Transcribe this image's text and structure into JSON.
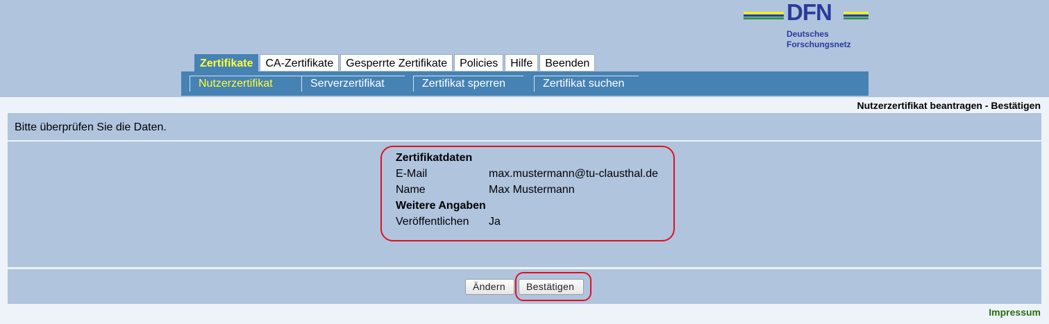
{
  "logo": {
    "name": "DFN",
    "subtitle_line1": "Deutsches",
    "subtitle_line2": "Forschungsnetz",
    "colors": {
      "blue": "#2b3a9a",
      "yellow": "#f4f400",
      "green": "#2a9a3a"
    }
  },
  "tabs": [
    {
      "label": "Zertifikate",
      "active": true
    },
    {
      "label": "CA-Zertifikate",
      "active": false
    },
    {
      "label": "Gesperrte Zertifikate",
      "active": false
    },
    {
      "label": "Policies",
      "active": false
    },
    {
      "label": "Hilfe",
      "active": false
    },
    {
      "label": "Beenden",
      "active": false
    }
  ],
  "subnav": [
    {
      "label": "Nutzerzertifikat",
      "active": true
    },
    {
      "label": "Serverzertifikat",
      "active": false
    },
    {
      "label": "Zertifikat sperren",
      "active": false
    },
    {
      "label": "Zertifikat suchen",
      "active": false
    }
  ],
  "page_title": "Nutzerzertifikat beantragen - Bestätigen",
  "instruction": "Bitte überprüfen Sie die Daten.",
  "certificate": {
    "heading": "Zertifikatdaten",
    "email_label": "E-Mail",
    "email_value": "max.mustermann@tu-clausthal.de",
    "name_label": "Name",
    "name_value": "Max Mustermann"
  },
  "additional": {
    "heading": "Weitere Angaben",
    "publish_label": "Veröffentlichen",
    "publish_value": "Ja"
  },
  "buttons": {
    "change": "Ändern",
    "confirm": "Bestätigen"
  },
  "footer": {
    "impressum": "Impressum"
  },
  "colors": {
    "header_bg": "#b0c4de",
    "nav_bg": "#4682b4",
    "active_text": "#ffff33",
    "highlight": "#e01020",
    "impressum": "#2b6b12"
  }
}
